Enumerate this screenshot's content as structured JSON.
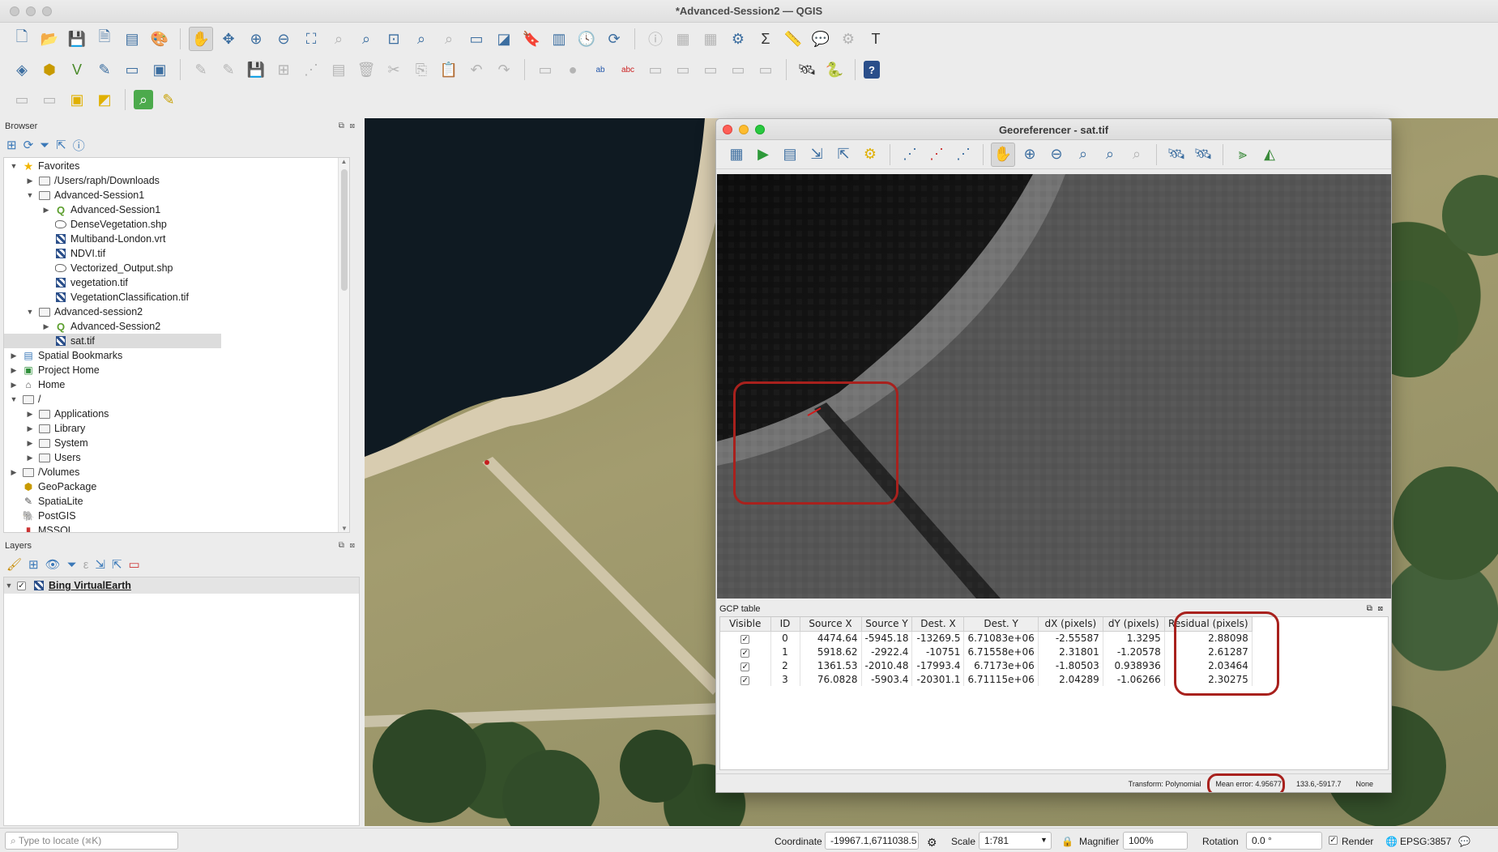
{
  "window": {
    "title": "*Advanced-Session2 — QGIS"
  },
  "toolbars": {
    "row1": [
      "new-project-icon",
      "open-project-icon",
      "save-project-icon",
      "new-print-layout-icon",
      "layout-manager-icon",
      "style-manager-icon",
      "|",
      "pan-icon",
      "pan-to-selection-icon",
      "zoom-in-icon",
      "zoom-out-icon",
      "zoom-full-icon",
      "zoom-to-selection-icon",
      "zoom-to-layer-icon",
      "zoom-native-icon",
      "zoom-last-icon",
      "zoom-next-icon",
      "new-map-view-icon",
      "new-3d-view-icon",
      "new-bookmark-icon",
      "show-bookmarks-icon",
      "temporal-controller-icon",
      "refresh-icon",
      "|",
      "identify-icon",
      "attribute-table-icon",
      "field-calculator-icon",
      "processing-toolbox-icon",
      "statistics-icon",
      "measure-icon",
      "map-tips-icon",
      "select-icon",
      "text-annotation-icon"
    ],
    "row2": [
      "data-source-manager-icon",
      "new-geopackage-layer-icon",
      "new-shapefile-layer-icon",
      "new-temp-layer-icon",
      "new-virtual-layer-icon",
      "georeferencer-icon",
      "|",
      "digitize-icon",
      "edit-pencil-icon",
      "save-edits-icon",
      "add-feature-icon",
      "vertex-tool-icon",
      "modify-attributes-icon",
      "delete-selected-icon",
      "cut-features-icon",
      "copy-features-icon",
      "paste-features-icon",
      "undo-icon",
      "redo-icon",
      "|",
      "label-tool-icon",
      "pin-label-icon",
      "label-highlight-icon",
      "label-abc-icon",
      "show-hide-label-icon",
      "move-label-icon",
      "rotate-label-icon",
      "change-label-icon",
      "label-props-icon",
      "|",
      "plugins-icon",
      "python-console-icon",
      "|",
      "help-icon"
    ],
    "row3": [
      "select-by-area-icon",
      "deselect-icon",
      "select-by-expression-icon",
      "select-location-icon",
      "|",
      "locator-icon",
      "identify-features-icon"
    ]
  },
  "browser": {
    "title": "Browser",
    "tree": [
      {
        "level": 0,
        "arrow": "down",
        "icon": "star-icon",
        "label": "Favorites"
      },
      {
        "level": 1,
        "arrow": "right",
        "icon": "folder-icon",
        "label": "/Users/raph/Downloads"
      },
      {
        "level": 1,
        "arrow": "down",
        "icon": "folder-icon",
        "label": "Advanced-Session1"
      },
      {
        "level": 2,
        "arrow": "right",
        "icon": "qgis-project-icon",
        "label": "Advanced-Session1"
      },
      {
        "level": 2,
        "arrow": "",
        "icon": "vector-icon",
        "label": "DenseVegetation.shp"
      },
      {
        "level": 2,
        "arrow": "",
        "icon": "raster-icon",
        "label": "Multiband-London.vrt"
      },
      {
        "level": 2,
        "arrow": "",
        "icon": "raster-icon",
        "label": "NDVI.tif"
      },
      {
        "level": 2,
        "arrow": "",
        "icon": "vector-icon",
        "label": "Vectorized_Output.shp"
      },
      {
        "level": 2,
        "arrow": "",
        "icon": "raster-icon",
        "label": "vegetation.tif"
      },
      {
        "level": 2,
        "arrow": "",
        "icon": "raster-icon",
        "label": "VegetationClassification.tif"
      },
      {
        "level": 1,
        "arrow": "down",
        "icon": "folder-icon",
        "label": "Advanced-session2"
      },
      {
        "level": 2,
        "arrow": "right",
        "icon": "qgis-project-icon",
        "label": "Advanced-Session2"
      },
      {
        "level": 2,
        "arrow": "",
        "icon": "raster-icon",
        "label": "sat.tif",
        "selected": true
      },
      {
        "level": 0,
        "arrow": "right",
        "icon": "bookmark-icon",
        "label": "Spatial Bookmarks"
      },
      {
        "level": 0,
        "arrow": "right",
        "icon": "project-home-icon",
        "label": "Project Home"
      },
      {
        "level": 0,
        "arrow": "right",
        "icon": "home-icon",
        "label": "Home"
      },
      {
        "level": 0,
        "arrow": "down",
        "icon": "folder-icon",
        "label": "/"
      },
      {
        "level": 1,
        "arrow": "right",
        "icon": "folder-icon",
        "label": "Applications"
      },
      {
        "level": 1,
        "arrow": "right",
        "icon": "folder-icon",
        "label": "Library"
      },
      {
        "level": 1,
        "arrow": "right",
        "icon": "folder-icon",
        "label": "System"
      },
      {
        "level": 1,
        "arrow": "right",
        "icon": "folder-icon",
        "label": "Users"
      },
      {
        "level": 0,
        "arrow": "right",
        "icon": "folder-icon",
        "label": "/Volumes"
      },
      {
        "level": 0,
        "arrow": "",
        "icon": "geopackage-icon",
        "label": "GeoPackage"
      },
      {
        "level": 0,
        "arrow": "",
        "icon": "spatialite-icon",
        "label": "SpatiaLite"
      },
      {
        "level": 0,
        "arrow": "",
        "icon": "postgis-icon",
        "label": "PostGIS"
      },
      {
        "level": 0,
        "arrow": "",
        "icon": "mssql-icon",
        "label": "MSSQL"
      }
    ]
  },
  "layers": {
    "title": "Layers",
    "items": [
      {
        "label": "Bing VirtualEarth",
        "checked": true
      }
    ]
  },
  "georeferencer": {
    "title": "Georeferencer - sat.tif",
    "gcp_title": "GCP table",
    "columns": [
      "Visible",
      "ID",
      "Source X",
      "Source Y",
      "Dest. X",
      "Dest. Y",
      "dX (pixels)",
      "dY (pixels)",
      "Residual (pixels)"
    ],
    "rows": [
      [
        "✓",
        "0",
        "4474.64",
        "-5945.18",
        "-13269.5",
        "6.71083e+06",
        "-2.55587",
        "1.3295",
        "2.88098"
      ],
      [
        "✓",
        "1",
        "5918.62",
        "-2922.4",
        "-10751",
        "6.71558e+06",
        "2.31801",
        "-1.20578",
        "2.61287"
      ],
      [
        "✓",
        "2",
        "1361.53",
        "-2010.48",
        "-17993.4",
        "6.7173e+06",
        "-1.80503",
        "0.938936",
        "2.03464"
      ],
      [
        "✓",
        "3",
        "76.0828",
        "-5903.4",
        "-20301.1",
        "6.71115e+06",
        "2.04289",
        "-1.06266",
        "2.30275"
      ]
    ],
    "status": {
      "transform": "Transform: Polynomial",
      "mean_error": "Mean error: 4.95677",
      "coords": "133.6,-5917.7",
      "crs": "None"
    }
  },
  "statusbar": {
    "locate_placeholder": "Type to locate (⌘K)",
    "coordinate_label": "Coordinate",
    "coordinate_value": "-19967.1,6711038.5",
    "scale_label": "Scale",
    "scale_value": "1:781",
    "magnifier_label": "Magnifier",
    "magnifier_value": "100%",
    "rotation_label": "Rotation",
    "rotation_value": "0.0 °",
    "render_label": "Render",
    "crs": "EPSG:3857"
  },
  "colors": {
    "highlight_red": "#a8211d",
    "accent_blue": "#3a78b8",
    "lake": "#0f1a22",
    "path": "#d8ccb0"
  }
}
